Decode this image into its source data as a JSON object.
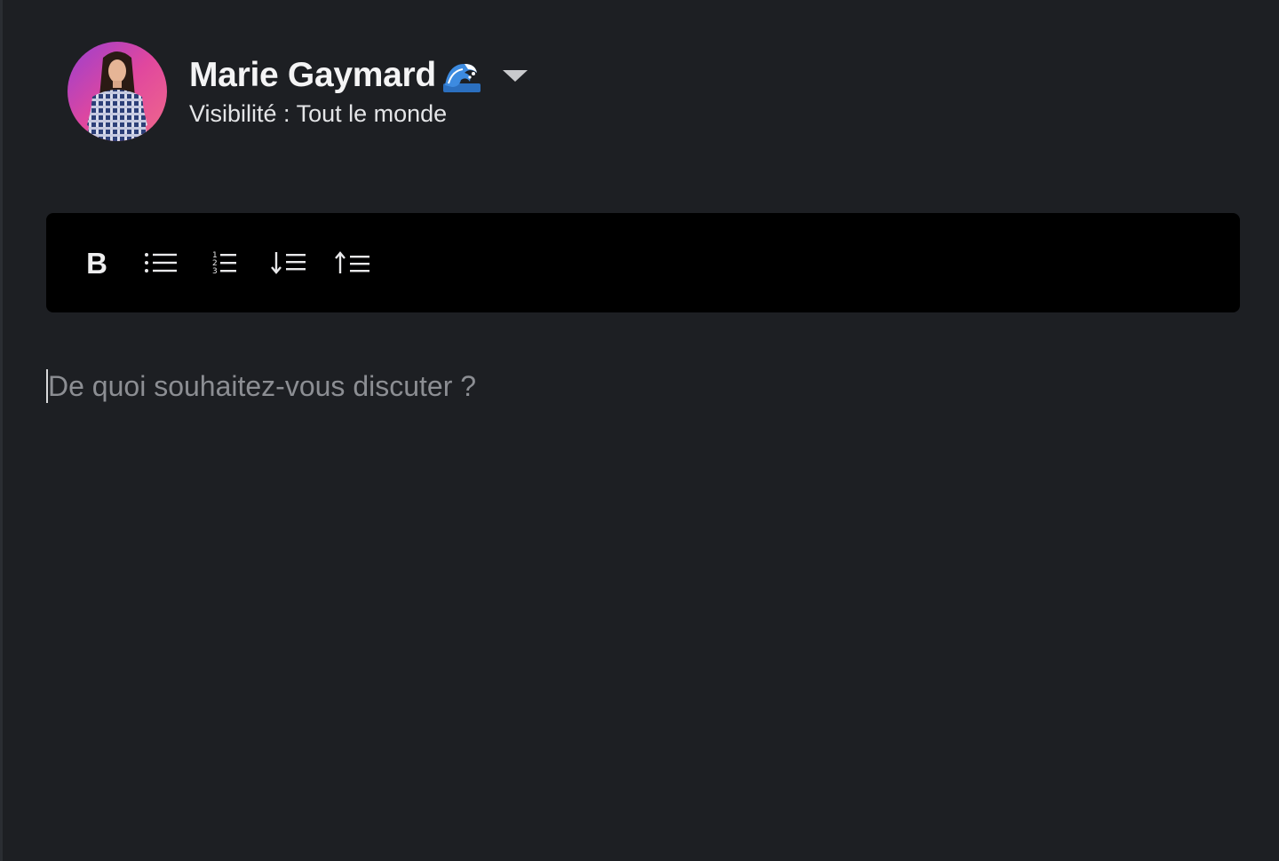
{
  "author": {
    "name": "Marie Gaymard",
    "emoji_icon": "wave-icon",
    "visibility_label": "Visibilité : Tout le monde",
    "menu_icon": "chevron-down-icon"
  },
  "toolbar": {
    "buttons": [
      {
        "name": "bold",
        "label": "B",
        "icon": "bold-icon"
      },
      {
        "name": "bullet-list",
        "icon": "bullet-list-icon"
      },
      {
        "name": "numbered-list",
        "icon": "numbered-list-icon"
      },
      {
        "name": "sort-descending",
        "icon": "sort-down-icon"
      },
      {
        "name": "sort-ascending",
        "icon": "sort-up-icon"
      }
    ]
  },
  "editor": {
    "placeholder": "De quoi souhaitez-vous discuter ?",
    "value": ""
  },
  "colors": {
    "background": "#1d1f23",
    "toolbar_background": "#000000",
    "text": "#f4f4f5",
    "placeholder": "#8c8e93"
  }
}
